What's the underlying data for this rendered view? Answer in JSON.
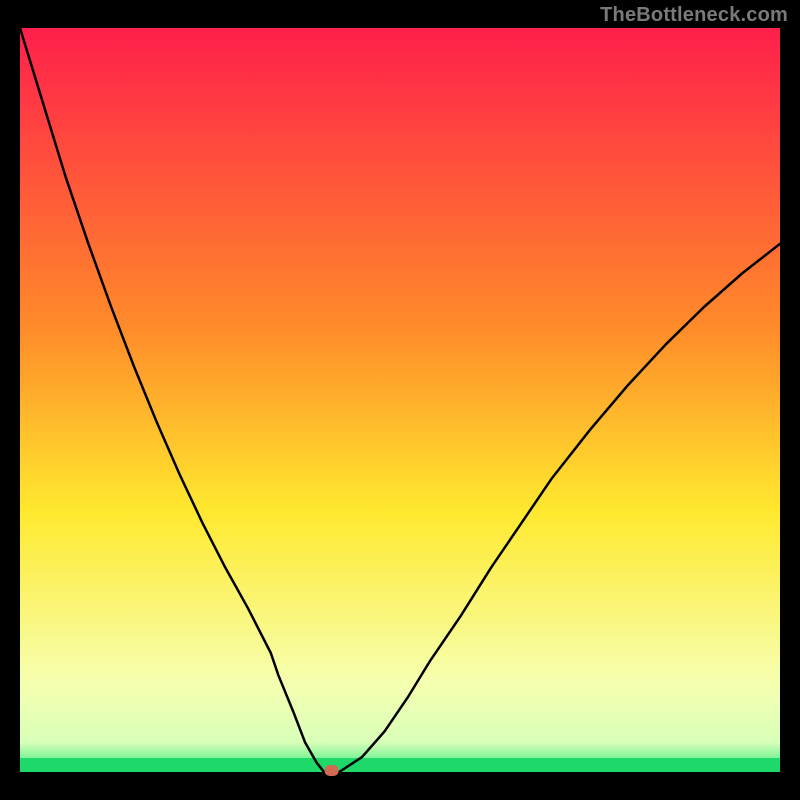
{
  "watermark": "TheBottleneck.com",
  "chart_data": {
    "type": "line",
    "title": "",
    "xlabel": "",
    "ylabel": "",
    "xlim": [
      0,
      100
    ],
    "ylim": [
      0,
      100
    ],
    "x": [
      0,
      3,
      6,
      9,
      12,
      15,
      18,
      21,
      24,
      27,
      30,
      33,
      34,
      36,
      37.5,
      39,
      40,
      42,
      45,
      48,
      51,
      54,
      58,
      62,
      66,
      70,
      75,
      80,
      85,
      90,
      95,
      100
    ],
    "values": [
      100,
      90,
      80,
      71,
      62.5,
      54.5,
      47,
      40,
      33.5,
      27.5,
      22,
      16,
      13,
      8,
      4,
      1.3,
      0,
      0,
      2,
      5.5,
      10,
      15,
      21,
      27.5,
      33.5,
      39.5,
      46,
      52,
      57.5,
      62.5,
      67,
      71
    ],
    "marker_x": 41,
    "marker_y": 0,
    "plateau_x_range": [
      38,
      43
    ],
    "green_band_y_range": [
      0,
      3
    ],
    "pale_yellow_band_y_range": [
      3,
      12
    ],
    "gradient_stops": [
      {
        "offset": 0,
        "color": "#ff1f4b"
      },
      {
        "offset": 40,
        "color": "#ff8a2a"
      },
      {
        "offset": 65,
        "color": "#ffe92e"
      },
      {
        "offset": 88,
        "color": "#f6ffb0"
      },
      {
        "offset": 96,
        "color": "#d8ffb8"
      },
      {
        "offset": 100,
        "color": "#35e97a"
      }
    ]
  }
}
